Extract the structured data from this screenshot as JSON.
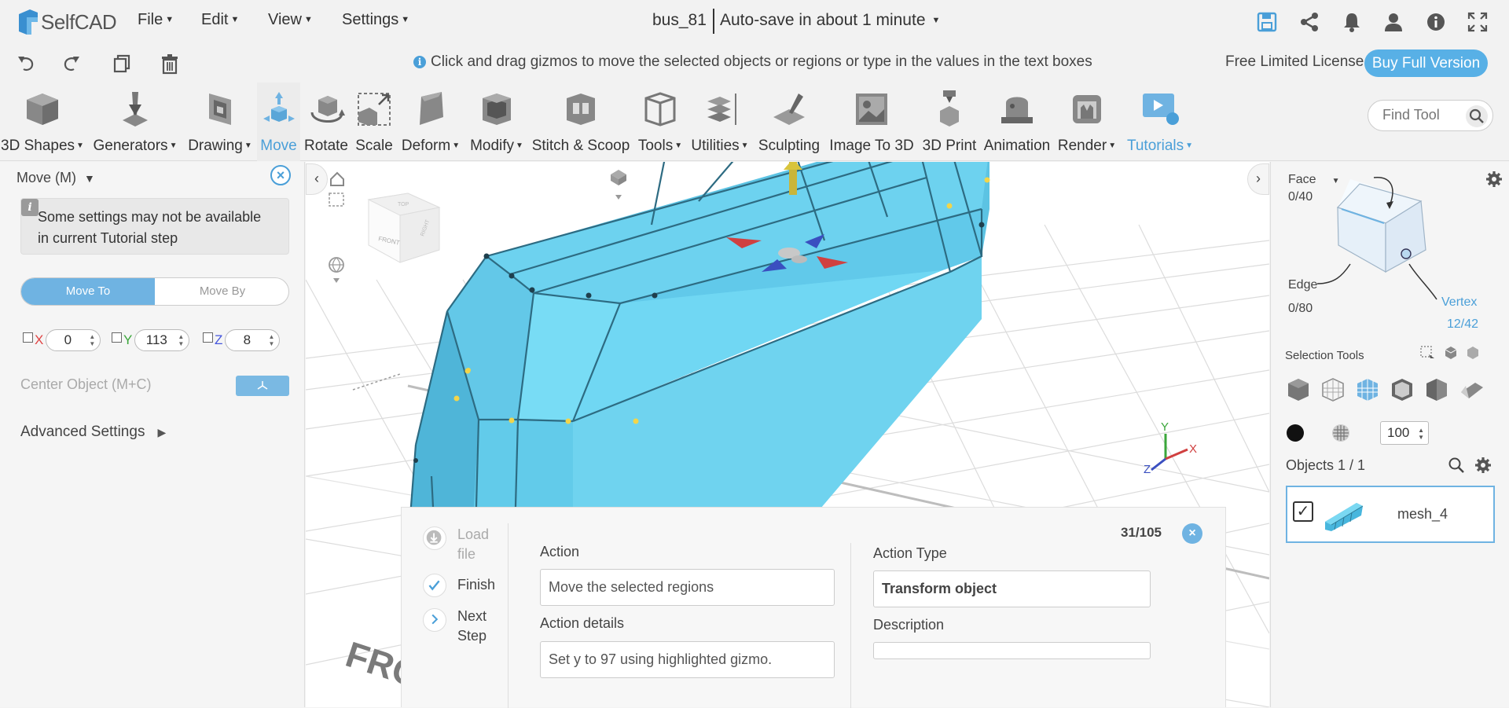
{
  "app": {
    "name": "SelfCAD"
  },
  "menu": {
    "file": "File",
    "edit": "Edit",
    "view": "View",
    "settings": "Settings"
  },
  "document": {
    "filename": "bus_81",
    "autosave": "Auto-save in about 1 minute"
  },
  "hint": "Click and drag gizmos to move the selected objects or regions or type in the values in the text boxes",
  "license": {
    "label": "Free Limited License",
    "buy_button": "Buy Full Version"
  },
  "toolbar": {
    "shapes": "3D Shapes",
    "generators": "Generators",
    "drawing": "Drawing",
    "move": "Move",
    "rotate": "Rotate",
    "scale": "Scale",
    "deform": "Deform",
    "modify": "Modify",
    "stitch": "Stitch & Scoop",
    "tools": "Tools",
    "utilities": "Utilities",
    "sculpting": "Sculpting",
    "image3d": "Image To 3D",
    "print3d": "3D Print",
    "animation": "Animation",
    "render": "Render",
    "tutorials": "Tutorials",
    "find_placeholder": "Find Tool"
  },
  "left_panel": {
    "title": "Move (M)",
    "note": "Some settings may not be available in current Tutorial step",
    "mode_move_to": "Move To",
    "mode_move_by": "Move By",
    "x_label": "X",
    "x_value": "0",
    "y_label": "Y",
    "y_value": "113",
    "z_label": "Z",
    "z_value": "8",
    "center_object": "Center Object (M+C)",
    "advanced": "Advanced Settings"
  },
  "viewport": {
    "cube_front": "FRONT",
    "cube_top": "TOP",
    "cube_right": "RIGHT",
    "axis_x": "X",
    "axis_y": "Y",
    "axis_z": "Z",
    "floor_text": "FRONT"
  },
  "tutorial": {
    "step_load": "Load file",
    "step_finish": "Finish",
    "step_next": "Next Step",
    "action_label": "Action",
    "action_value": "Move the selected regions",
    "details_label": "Action details",
    "details_value": "Set y to 97 using highlighted gizmo.",
    "type_label": "Action Type",
    "type_value": "Transform object",
    "description_label": "Description",
    "description_value": "",
    "counter": "31/105"
  },
  "right_panel": {
    "face_label": "Face",
    "face_count": "0/40",
    "edge_label": "Edge",
    "edge_count": "0/80",
    "vertex_label": "Vertex",
    "vertex_count": "12/42",
    "selection_tools": "Selection Tools",
    "opacity": "100",
    "objects_label": "Objects 1 / 1",
    "object_name": "mesh_4"
  },
  "colors": {
    "accent": "#4a9fd8",
    "mesh": "#72d4f0",
    "mesh_dark": "#3fa8cc",
    "button": "#58b0e6"
  }
}
